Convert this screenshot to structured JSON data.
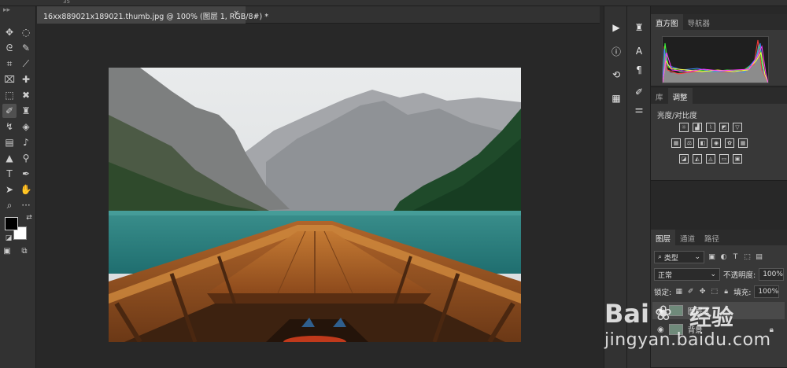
{
  "topstrip": {
    "tiny_text": "35"
  },
  "document": {
    "tab_title": "16xx889021x189021.thumb.jpg @ 100% (图层 1, RGB/8#) *",
    "close_glyph": "×"
  },
  "toolbar": {
    "tools": [
      "move-tool",
      "marquee-tool",
      "lasso-tool",
      "magic-wand-tool",
      "crop-tool",
      "eyedropper-tool",
      "spot-healing-tool",
      "brush-tool",
      "clone-stamp-tool",
      "history-brush-tool",
      "eraser-tool",
      "gradient-tool",
      "blur-tool",
      "dodge-tool",
      "pen-tool",
      "type-tool",
      "path-selection-tool",
      "shape-tool",
      "hand-tool",
      "zoom-tool",
      "more-tools"
    ],
    "foreground_color": "#000000",
    "background_color": "#ffffff"
  },
  "panels": {
    "histogram": {
      "tabs": [
        "直方图",
        "导航器"
      ]
    },
    "adjustments": {
      "tabs": [
        "库",
        "调整"
      ],
      "title": "亮度/对比度"
    },
    "layers": {
      "tabs": [
        "图层",
        "通道",
        "路径"
      ],
      "filter_label": "类型",
      "blend_mode": "正常",
      "opacity_label": "不透明度:",
      "opacity_value": "100%",
      "lock_label": "锁定:",
      "fill_label": "填充:",
      "fill_value": "100%",
      "items": [
        {
          "name": "图层 1",
          "selected": true
        },
        {
          "name": "背景",
          "selected": false
        }
      ]
    }
  },
  "watermark": {
    "brand": "Bai",
    "brand_cn": "经验",
    "url": "jingyan.baidu.com"
  },
  "colors": {
    "app_bg": "#282828",
    "panel_bg": "#383838",
    "toolbar_bg": "#323232"
  }
}
